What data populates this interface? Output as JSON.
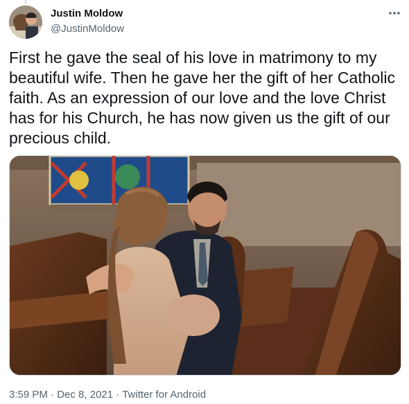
{
  "author": {
    "name": "Justin Moldow",
    "handle": "@JustinMoldow"
  },
  "tweet": {
    "text": "First he gave the seal of his love in matrimony to my beautiful wife. Then he gave her the gift of her Catholic faith. As an expression of our love and the love Christ has for his Church, he has now given us the gift of our precious child.",
    "time": "3:59 PM",
    "separator": "·",
    "date": "Dec 8, 2021",
    "source": "Twitter for Android"
  },
  "icons": {
    "more": "more-options-icon"
  },
  "colors": {
    "text_primary": "#0f1419",
    "text_secondary": "#536471",
    "border": "#cfd9de"
  }
}
